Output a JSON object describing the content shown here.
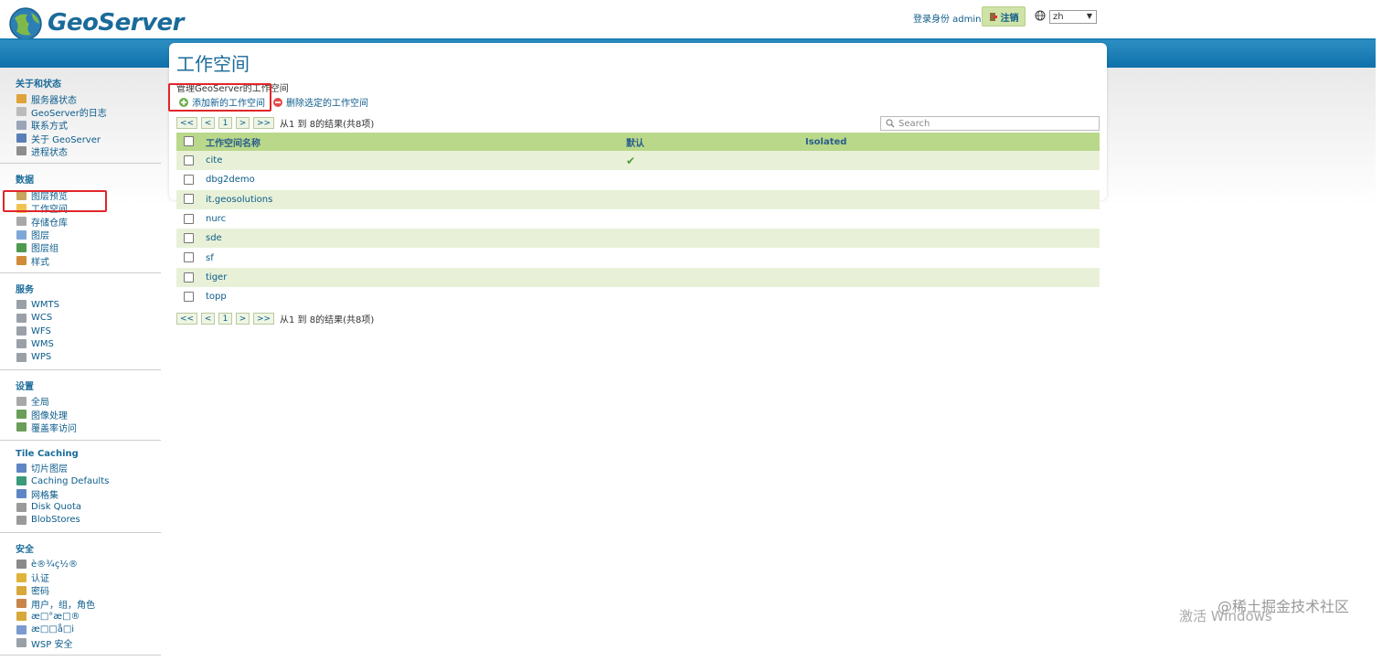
{
  "header": {
    "logo_text": "GeoServer",
    "login_info": "登录身份 admin.",
    "logout_label": "注销",
    "lang": "zh"
  },
  "sidebar": {
    "sections": [
      {
        "title": "关于和状态",
        "items": [
          {
            "label": "服务器状态",
            "icon": "warning-icon",
            "color": "#e0a23a"
          },
          {
            "label": "GeoServer的日志",
            "icon": "document-icon",
            "color": "#bbbbbb"
          },
          {
            "label": "联系方式",
            "icon": "contact-card-icon",
            "color": "#9aa6b8"
          },
          {
            "label": "关于 GeoServer",
            "icon": "info-icon",
            "color": "#5a7fb8"
          },
          {
            "label": "进程状态",
            "icon": "gear-icon",
            "color": "#8d8d8d"
          }
        ]
      },
      {
        "title": "数据",
        "items": [
          {
            "label": "图层预览",
            "icon": "map-preview-icon",
            "color": "#c9a45c"
          },
          {
            "label": "工作空间",
            "icon": "folder-icon",
            "color": "#f0c24e"
          },
          {
            "label": "存储仓库",
            "icon": "database-icon",
            "color": "#a8a8a8"
          },
          {
            "label": "图层",
            "icon": "layer-icon",
            "color": "#7ea8d8"
          },
          {
            "label": "图层组",
            "icon": "layer-group-icon",
            "color": "#4f9a4f"
          },
          {
            "label": "样式",
            "icon": "palette-icon",
            "color": "#d08a3a"
          }
        ]
      },
      {
        "title": "服务",
        "items": [
          {
            "label": "WMTS",
            "icon": "service-icon",
            "color": "#9aa0a8"
          },
          {
            "label": "WCS",
            "icon": "service-icon",
            "color": "#9aa0a8"
          },
          {
            "label": "WFS",
            "icon": "service-icon",
            "color": "#9aa0a8"
          },
          {
            "label": "WMS",
            "icon": "service-icon",
            "color": "#9aa0a8"
          },
          {
            "label": "WPS",
            "icon": "service-icon",
            "color": "#9aa0a8"
          }
        ]
      },
      {
        "title": "设置",
        "items": [
          {
            "label": "全局",
            "icon": "server-icon",
            "color": "#a8a8a8"
          },
          {
            "label": "图像处理",
            "icon": "image-icon",
            "color": "#6a9e5a"
          },
          {
            "label": "覆盖率访问",
            "icon": "coverage-icon",
            "color": "#6a9e5a"
          }
        ]
      },
      {
        "title": "Tile Caching",
        "items": [
          {
            "label": "切片图层",
            "icon": "tile-layer-icon",
            "color": "#5f86c4"
          },
          {
            "label": "Caching Defaults",
            "icon": "globe-icon",
            "color": "#3a9a7a"
          },
          {
            "label": "网格集",
            "icon": "grid-icon",
            "color": "#5f86c4"
          },
          {
            "label": "Disk Quota",
            "icon": "disk-icon",
            "color": "#9a9a9a"
          },
          {
            "label": "BlobStores",
            "icon": "blobstore-icon",
            "color": "#9a9a9a"
          }
        ]
      },
      {
        "title": "安全",
        "items": [
          {
            "label": "è®¾ç½®",
            "icon": "key-icon",
            "color": "#8a8a8a"
          },
          {
            "label": "认证",
            "icon": "shield-icon",
            "color": "#e0b43a"
          },
          {
            "label": "密码",
            "icon": "lock-icon",
            "color": "#d8a83a"
          },
          {
            "label": "用户，组，角色",
            "icon": "users-icon",
            "color": "#c8854a"
          },
          {
            "label": "æ□°æ□®",
            "icon": "data-security-icon",
            "color": "#d8a83a"
          },
          {
            "label": "æ□□å□i",
            "icon": "service-security-icon",
            "color": "#7a9ad0"
          },
          {
            "label": "WSP 安全",
            "icon": "wps-security-icon",
            "color": "#9aa0a8"
          }
        ]
      }
    ]
  },
  "main": {
    "title": "工作空间",
    "description": "管理GeoServer的工作空间",
    "add_link": "添加新的工作空间",
    "remove_link": "删除选定的工作空间",
    "pager": {
      "first": "<<",
      "prev": "<",
      "page": "1",
      "next": ">",
      "last": ">>",
      "result": "从1 到 8的结果(共8项)"
    },
    "search_placeholder": "Search",
    "table": {
      "headers": [
        "工作空间名称",
        "默认",
        "Isolated"
      ],
      "rows": [
        {
          "name": "cite",
          "default": "✔"
        },
        {
          "name": "dbg2demo",
          "default": ""
        },
        {
          "name": "it.geosolutions",
          "default": ""
        },
        {
          "name": "nurc",
          "default": ""
        },
        {
          "name": "sde",
          "default": ""
        },
        {
          "name": "sf",
          "default": ""
        },
        {
          "name": "tiger",
          "default": ""
        },
        {
          "name": "topp",
          "default": ""
        }
      ]
    }
  },
  "watermark": {
    "line1": "激活 Windows",
    "line2": "@稀土掘金技术社区"
  }
}
